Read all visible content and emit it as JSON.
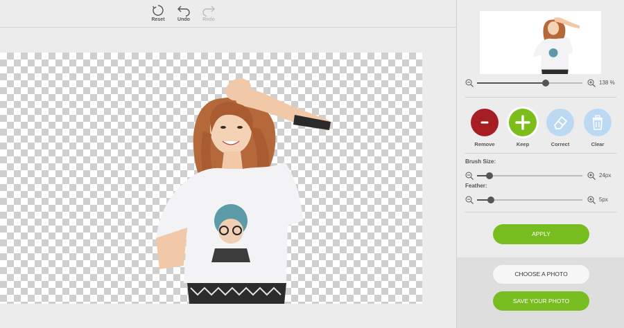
{
  "toolbar": {
    "reset_label": "Reset",
    "undo_label": "Undo",
    "redo_label": "Redo"
  },
  "preview": {
    "zoom_value": "138 %",
    "zoom_level": 0.65
  },
  "brushes": {
    "remove_label": "Remove",
    "keep_label": "Keep",
    "correct_label": "Correct",
    "clear_label": "Clear",
    "remove_color": "#a61d24",
    "keep_color": "#7cbd1a",
    "correct_color": "#bcd9f3",
    "clear_color": "#bcd9f3"
  },
  "settings": {
    "brush_size_label": "Brush Size:",
    "brush_size_value": "24px",
    "brush_size_level": 0.12,
    "feather_label": "Feather:",
    "feather_value": "5px",
    "feather_level": 0.13
  },
  "actions": {
    "apply_label": "APPLY",
    "choose_label": "CHOOSE A PHOTO",
    "save_label": "SAVE YOUR PHOTO",
    "accent_color": "#77bd1f"
  }
}
